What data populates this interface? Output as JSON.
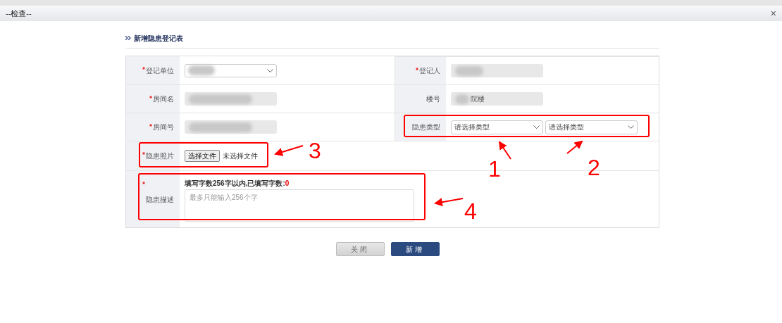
{
  "dialog": {
    "title": "--检查--",
    "close": "×"
  },
  "form": {
    "heading": "新增隐患登记表",
    "fields": [
      {
        "label": "登记单位",
        "required": true,
        "kind": "select"
      },
      {
        "label": "登记人",
        "required": true,
        "kind": "readonly"
      },
      {
        "label": "房间名",
        "required": true,
        "kind": "readonly"
      },
      {
        "label": "楼号",
        "required": false,
        "kind": "readonly",
        "value": "院楼"
      },
      {
        "label": "房间号",
        "required": true,
        "kind": "readonly"
      },
      {
        "label": "隐患类型",
        "required": false,
        "kind": "selects",
        "values": [
          "请选择类型",
          "请选择类型"
        ]
      },
      {
        "label": "隐患照片",
        "required": true,
        "kind": "file",
        "button": "选择文件",
        "status": "未选择文件"
      },
      {
        "label": "隐患描述",
        "required": true,
        "kind": "textarea",
        "hint": "填写字数256字以内,已填写字数:",
        "count": "0",
        "placeholder": "最多只能输入256个字"
      }
    ]
  },
  "buttons": [
    {
      "label": "关闭",
      "kind": "secondary"
    },
    {
      "label": "新增",
      "kind": "primary"
    }
  ],
  "annotations": [
    "1",
    "2",
    "3",
    "4"
  ]
}
